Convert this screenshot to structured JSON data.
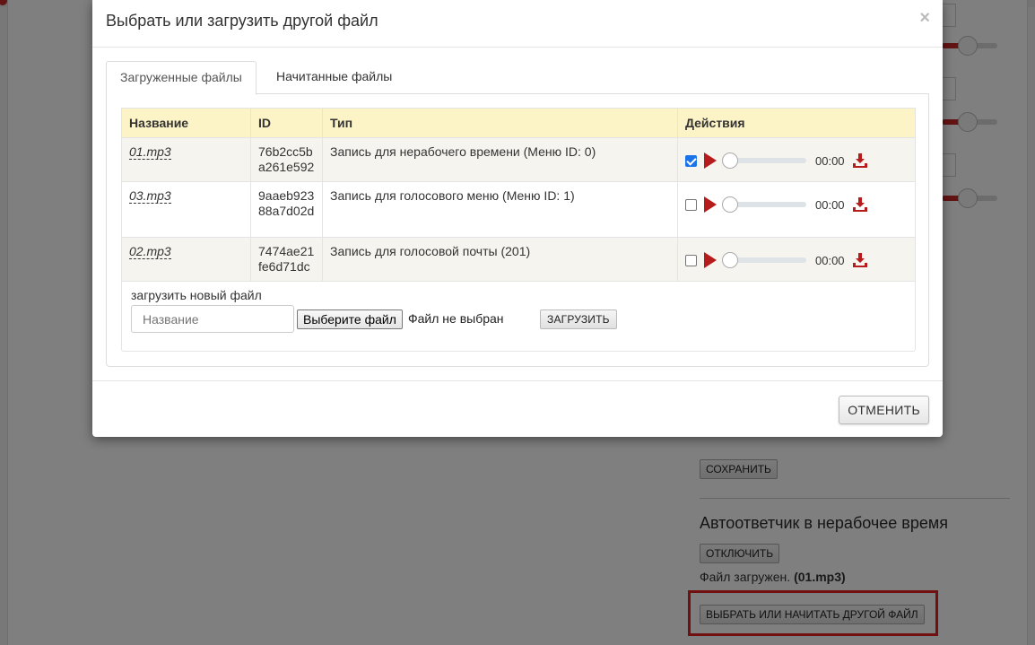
{
  "background": {
    "save_button": "СОХРАНИТЬ",
    "section_heading": "Автоответчик в нерабочее время",
    "disable_button": "ОТКЛЮЧИТЬ",
    "file_status_prefix": "Файл загружен.",
    "file_status_name": "(01.mp3)",
    "choose_file_button": "ВЫБРАТЬ ИЛИ НАЧИТАТЬ ДРУГОЙ ФАЙЛ",
    "highlight_color": "#e02020"
  },
  "modal": {
    "title": "Выбрать или загрузить другой файл",
    "close": "×",
    "tabs": [
      {
        "label": "Загруженные файлы",
        "active": true
      },
      {
        "label": "Начитанные файлы",
        "active": false
      }
    ],
    "table": {
      "headers": [
        "Название",
        "ID",
        "Тип",
        "Действия"
      ],
      "rows": [
        {
          "name": "01.mp3",
          "id": "76b2cc5ba261e592",
          "type": "Запись для нерабочего времени (Меню ID: 0)",
          "checked": true,
          "time": "00:00"
        },
        {
          "name": "03.mp3",
          "id": "9aaeb92388a7d02d",
          "type": "Запись для голосового меню (Меню ID: 1)",
          "checked": false,
          "time": "00:00"
        },
        {
          "name": "02.mp3",
          "id": "7474ae21fe6d71dc",
          "type": "Запись для голосовой почты (201)",
          "checked": false,
          "time": "00:00"
        }
      ]
    },
    "upload": {
      "label": "загрузить новый файл",
      "name_placeholder": "Название",
      "file_button": "Выберите файл",
      "no_file": "Файл не выбран",
      "upload_button": "ЗАГРУЗИТЬ"
    },
    "cancel_button": "ОТМЕНИТЬ"
  },
  "colors": {
    "accent": "#b71c1c",
    "header_bg": "#fcf3c6",
    "row_alt": "#f6f4ef"
  }
}
